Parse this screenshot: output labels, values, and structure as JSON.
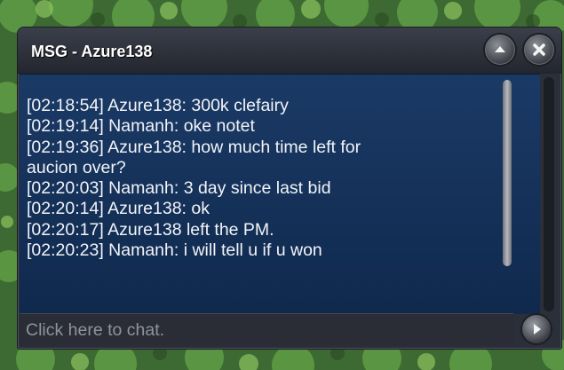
{
  "window": {
    "title": "MSG - Azure138"
  },
  "chat": {
    "messages": [
      "[02:18:54] Azure138: 300k clefairy",
      "[02:19:14] Namanh: oke notet",
      "[02:19:36] Azure138: how much time left for",
      "aucion over?",
      "[02:20:03] Namanh: 3 day since last bid",
      "[02:20:14] Azure138: ok",
      "[02:20:17] Azure138 left the PM.",
      "[02:20:23] Namanh: i will tell u if u won"
    ],
    "input_placeholder": "Click here to chat."
  },
  "icons": {
    "minimize": "chevron-up-icon",
    "close": "close-icon",
    "send": "play-arrow-icon"
  },
  "colors": {
    "chat_background": "#15345e",
    "text": "#f2f4f8",
    "frame": "#2b2f3a"
  }
}
